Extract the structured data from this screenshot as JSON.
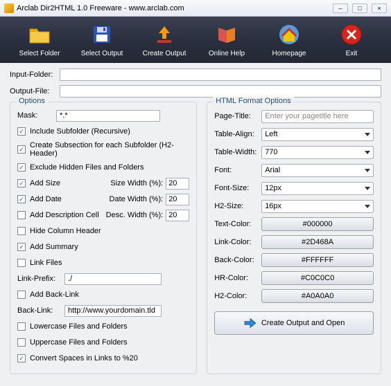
{
  "window": {
    "title": "Arclab Dir2HTML 1.0 Freeware - www.arclab.com"
  },
  "toolbar": [
    {
      "name": "select-folder",
      "label": "Select Folder"
    },
    {
      "name": "select-output",
      "label": "Select Output"
    },
    {
      "name": "create-output",
      "label": "Create Output"
    },
    {
      "name": "online-help",
      "label": "Online Help"
    },
    {
      "name": "homepage",
      "label": "Homepage"
    },
    {
      "name": "exit",
      "label": "Exit"
    }
  ],
  "paths": {
    "input_label": "Input-Folder:",
    "input_value": "",
    "output_label": "Output-File:",
    "output_value": ""
  },
  "options": {
    "legend": "Options",
    "mask_label": "Mask:",
    "mask_value": "*.*",
    "include_subfolder": {
      "label": "Include Subfolder (Recursive)",
      "checked": true
    },
    "create_subsection": {
      "label": "Create Subsection for each Subfolder (H2-Header)",
      "checked": true
    },
    "exclude_hidden": {
      "label": "Exclude Hidden Files and Folders",
      "checked": true
    },
    "add_size": {
      "label": "Add Size",
      "checked": true,
      "width_label": "Size Width (%):",
      "width": "20"
    },
    "add_date": {
      "label": "Add Date",
      "checked": true,
      "width_label": "Date Width (%):",
      "width": "20"
    },
    "add_desc": {
      "label": "Add Description Cell",
      "checked": false,
      "width_label": "Desc. Width (%):",
      "width": "20"
    },
    "hide_header": {
      "label": "Hide Column Header",
      "checked": false
    },
    "add_summary": {
      "label": "Add Summary",
      "checked": true
    },
    "link_files": {
      "label": "Link Files",
      "checked": false
    },
    "link_prefix_label": "Link-Prefix:",
    "link_prefix_value": "./",
    "add_backlink": {
      "label": "Add Back-Link",
      "checked": false
    },
    "backlink_label": "Back-Link:",
    "backlink_value": "http://www.yourdomain.tld",
    "lowercase": {
      "label": "Lowercase Files and Folders",
      "checked": false
    },
    "uppercase": {
      "label": "Uppercase Files and Folders",
      "checked": false
    },
    "convert_spaces": {
      "label": "Convert Spaces in Links to %20",
      "checked": true
    }
  },
  "format": {
    "legend": "HTML Format Options",
    "page_title_label": "Page-Title:",
    "page_title_placeholder": "Enter your pagetitle here",
    "page_title_value": "",
    "table_align_label": "Table-Align:",
    "table_align_value": "Left",
    "table_width_label": "Table-Width:",
    "table_width_value": "770",
    "font_label": "Font:",
    "font_value": "Arial",
    "font_size_label": "Font-Size:",
    "font_size_value": "12px",
    "h2_size_label": "H2-Size:",
    "h2_size_value": "16px",
    "text_color": {
      "label": "Text-Color:",
      "value": "#000000"
    },
    "link_color": {
      "label": "Link-Color:",
      "value": "#2D468A"
    },
    "back_color": {
      "label": "Back-Color:",
      "value": "#FFFFFF"
    },
    "hr_color": {
      "label": "HR-Color:",
      "value": "#C0C0C0"
    },
    "h2_color": {
      "label": "H2-Color:",
      "value": "#A0A0A0"
    }
  },
  "create_button": "Create Output and Open"
}
